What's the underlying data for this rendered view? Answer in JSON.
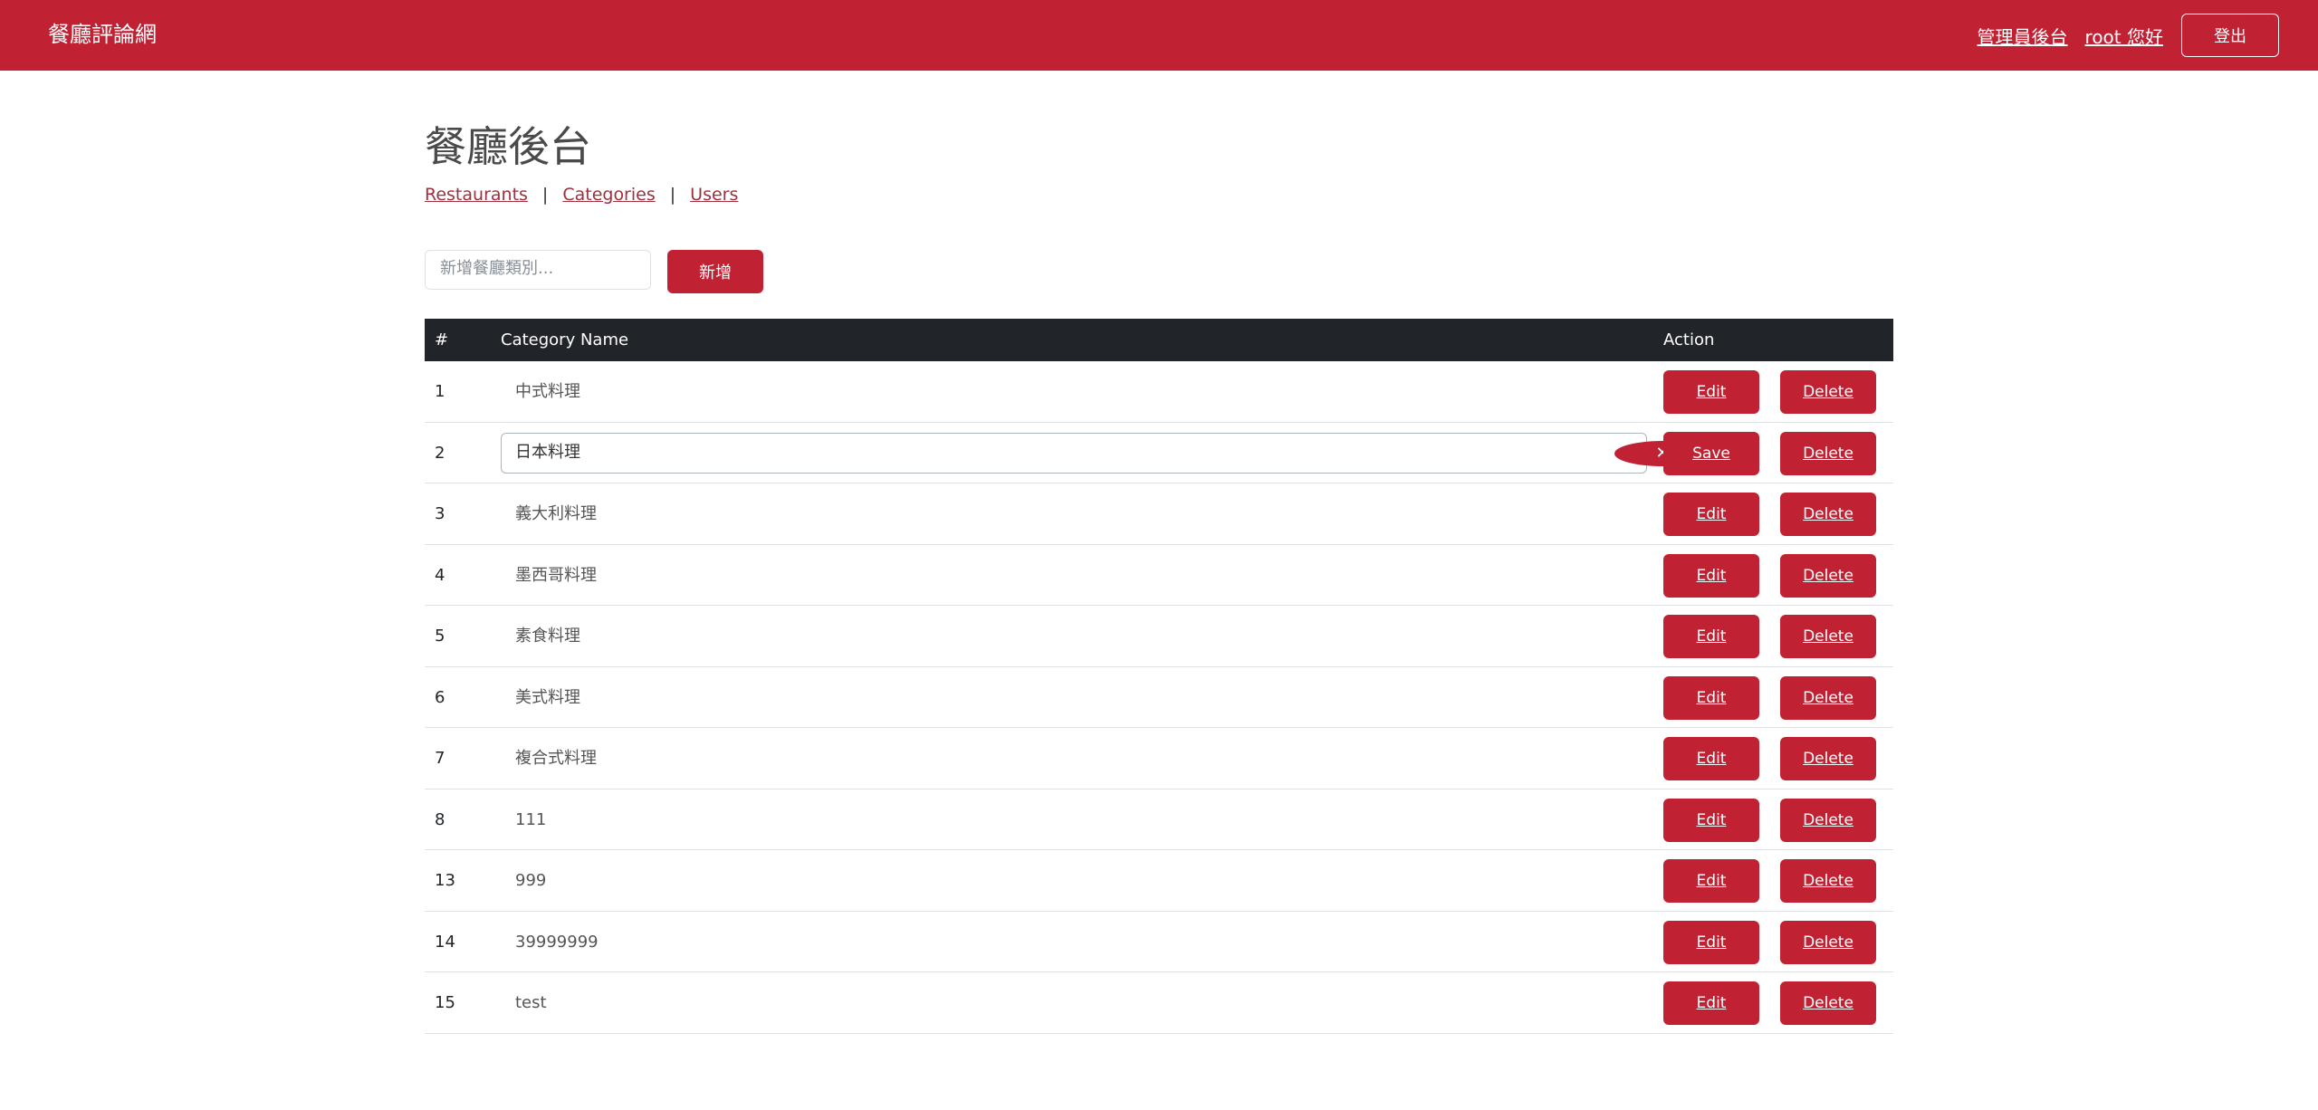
{
  "navbar": {
    "brand": "餐廳評論網",
    "admin_link": "管理員後台",
    "user_greeting": "root 您好",
    "logout": "登出"
  },
  "page": {
    "title": "餐廳後台",
    "tabs": [
      "Restaurants",
      "Categories",
      "Users"
    ],
    "separator": "|"
  },
  "new_category": {
    "placeholder": "新增餐廳類別...",
    "button": "新增"
  },
  "table": {
    "headers": {
      "id": "#",
      "name": "Category Name",
      "action": "Action"
    },
    "rows": [
      {
        "id": "1",
        "name": "中式料理",
        "editing": false
      },
      {
        "id": "2",
        "name": "日本料理",
        "editing": true
      },
      {
        "id": "3",
        "name": "義大利料理",
        "editing": false
      },
      {
        "id": "4",
        "name": "墨西哥料理",
        "editing": false
      },
      {
        "id": "5",
        "name": "素食料理",
        "editing": false
      },
      {
        "id": "6",
        "name": "美式料理",
        "editing": false
      },
      {
        "id": "7",
        "name": "複合式料理",
        "editing": false
      },
      {
        "id": "8",
        "name": "111",
        "editing": false
      },
      {
        "id": "13",
        "name": "999",
        "editing": false
      },
      {
        "id": "14",
        "name": "39999999",
        "editing": false
      },
      {
        "id": "15",
        "name": "test",
        "editing": false
      }
    ],
    "edit_label": "Edit",
    "save_label": "Save",
    "delete_label": "Delete",
    "clear_symbol": "✕"
  },
  "colors": {
    "brand_red": "#c12233",
    "header_dark": "#212529"
  }
}
